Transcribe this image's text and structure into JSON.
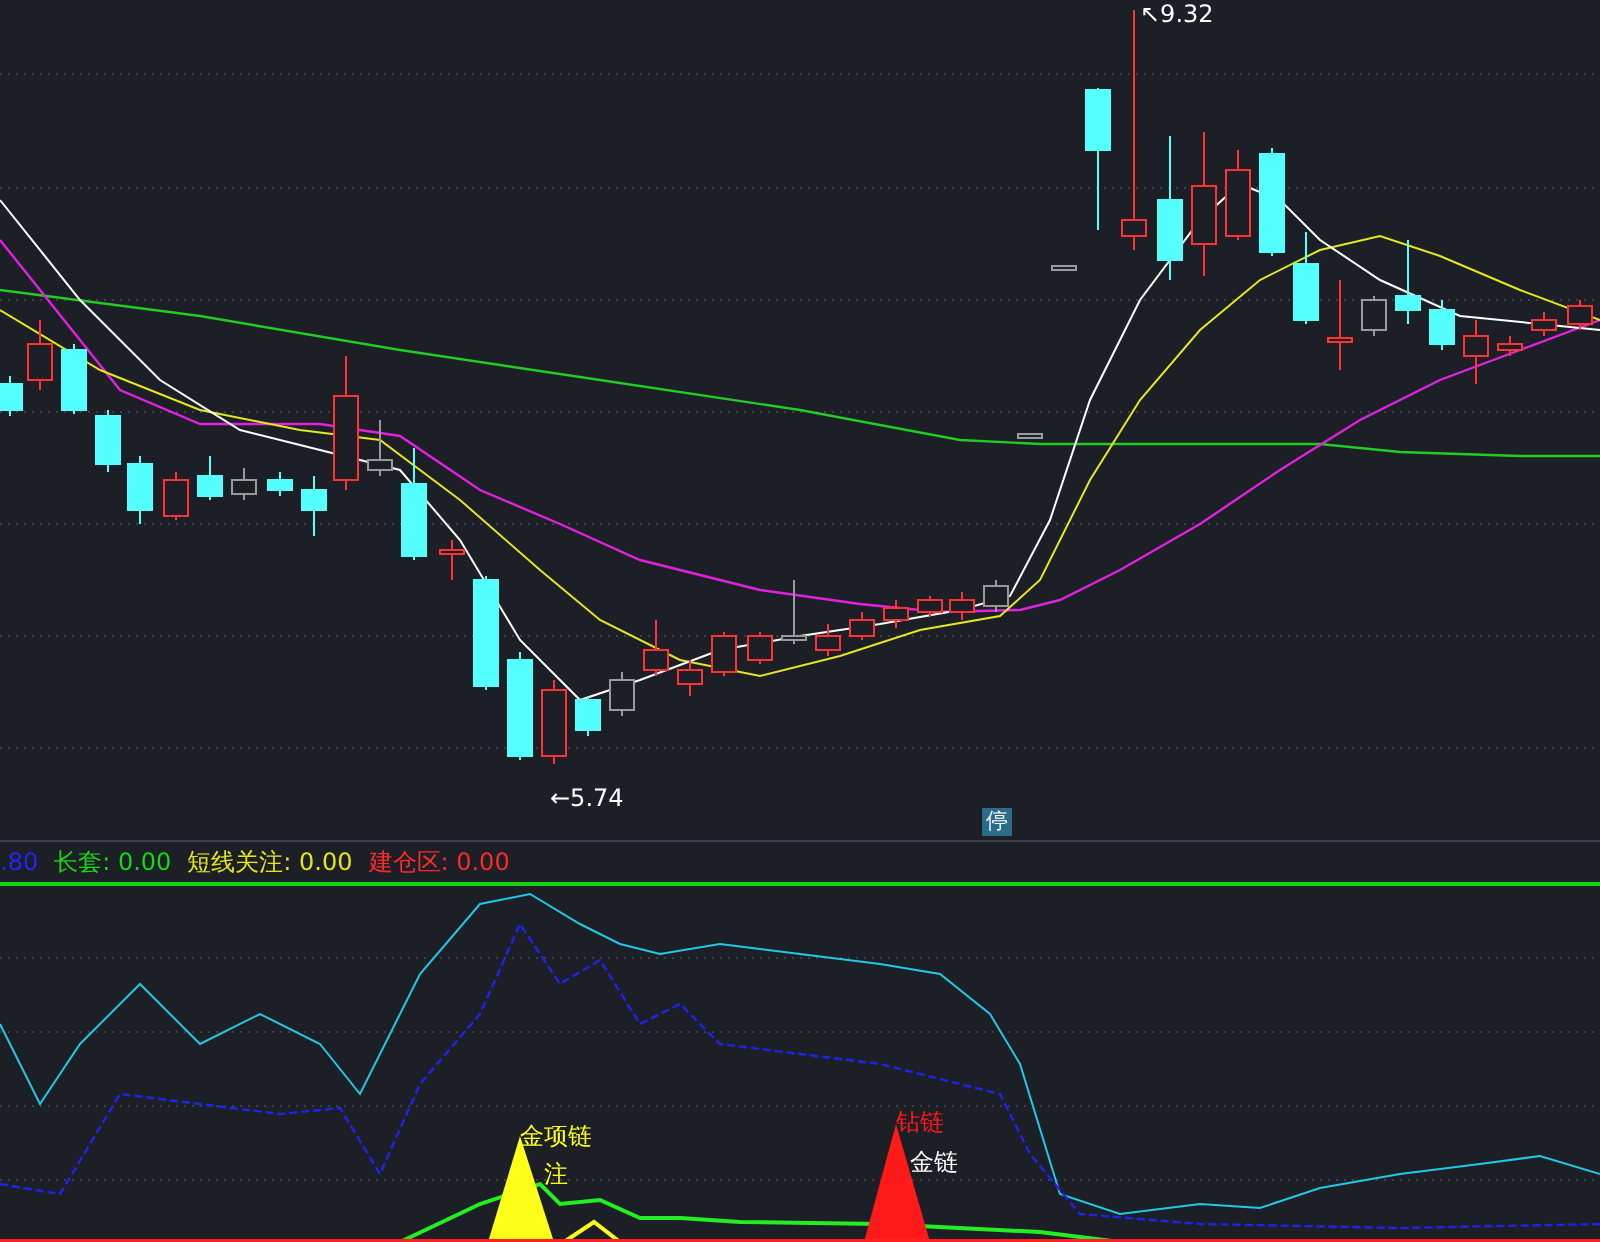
{
  "price_chart": {
    "high_marker": "↖9.32",
    "low_marker": "←5.74",
    "stop_badge": "停"
  },
  "legend": [
    {
      "text": ".80",
      "color": "#2424ff"
    },
    {
      "text": "长套: 0.00",
      "color": "#16d916"
    },
    {
      "text": "短线关注: 0.00",
      "color": "#e6e61a"
    },
    {
      "text": "建仓区: 0.00",
      "color": "#ff2a2a"
    }
  ],
  "signals": [
    {
      "text": "金项链",
      "color": "#ffff1a"
    },
    {
      "text": "注",
      "color": "#ffff1a"
    },
    {
      "text": "钻链",
      "color": "#ff1a1a"
    },
    {
      "text": "金链",
      "color": "#ffffff"
    }
  ]
}
